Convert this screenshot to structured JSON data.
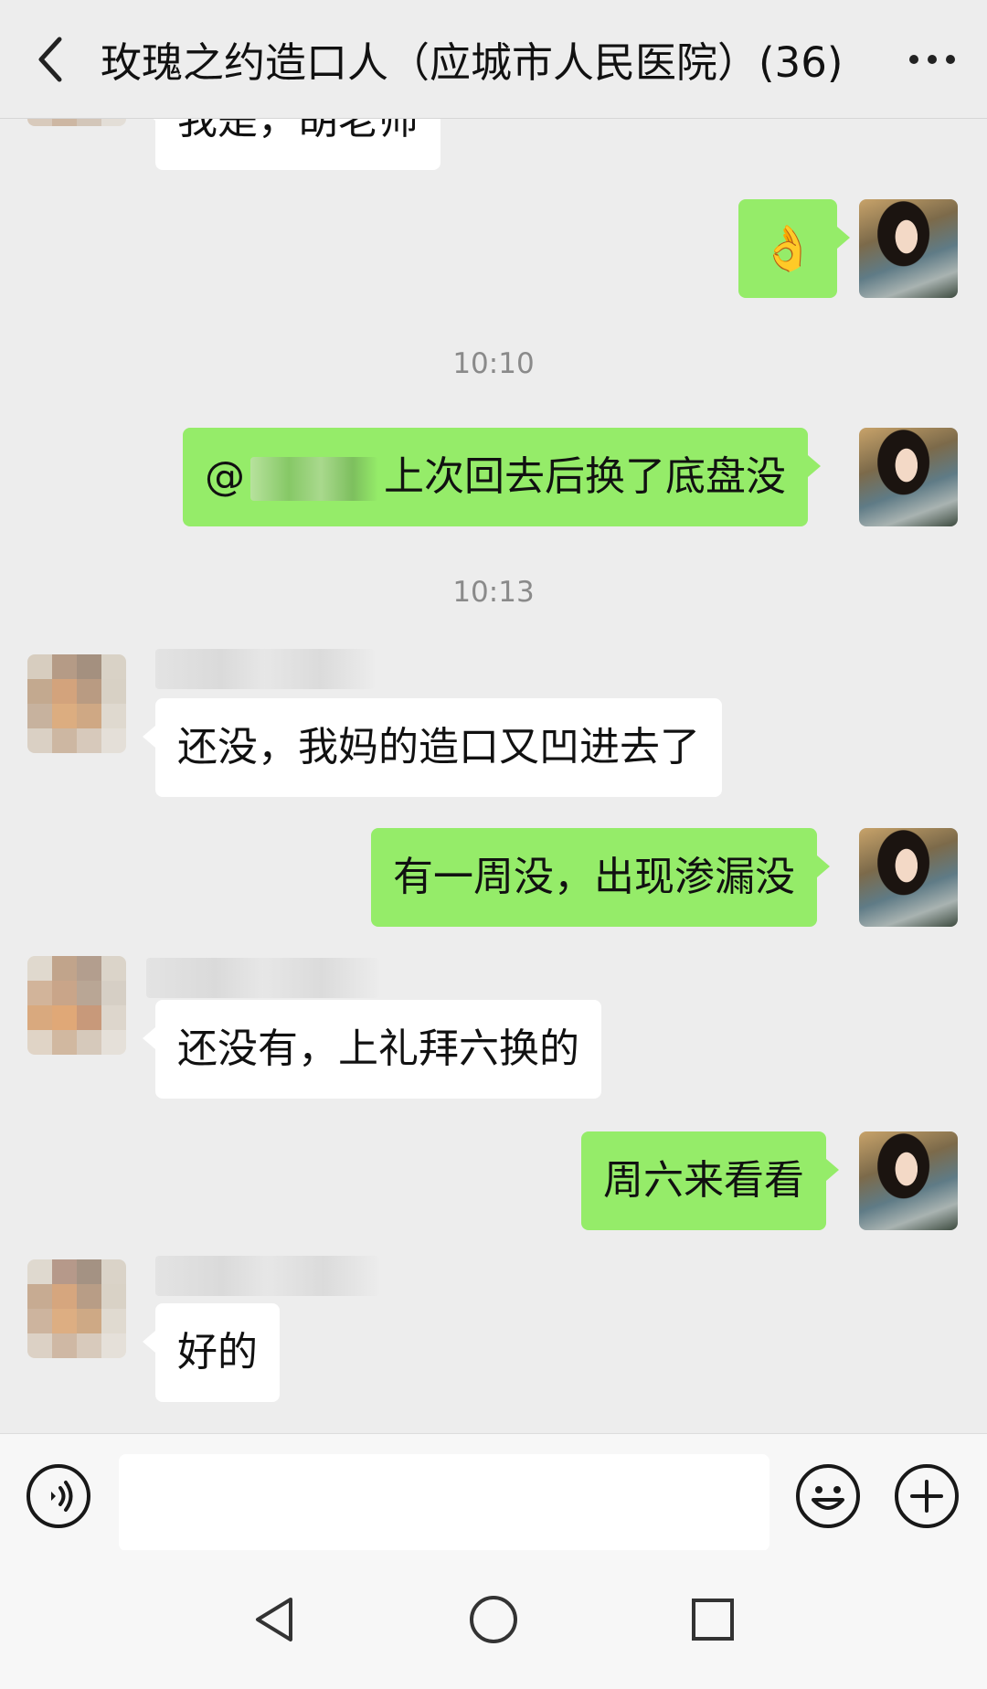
{
  "header": {
    "title": "玫瑰之约造口人（应城市人民医院）(36)"
  },
  "messages": [
    {
      "side": "in",
      "text": "我是，胡老师"
    },
    {
      "side": "out",
      "emoji": "👌"
    },
    {
      "timestamp": "10:10"
    },
    {
      "side": "out",
      "mention": "@",
      "text": "上次回去后换了底盘没"
    },
    {
      "timestamp": "10:13"
    },
    {
      "side": "in",
      "text": "还没，我妈的造口又凹进去了"
    },
    {
      "side": "out",
      "text": "有一周没，出现渗漏没"
    },
    {
      "side": "in",
      "text": "还没有，上礼拜六换的"
    },
    {
      "side": "out",
      "text": "周六来看看"
    },
    {
      "side": "in",
      "text": "好的"
    }
  ],
  "input": {
    "placeholder": ""
  },
  "colors": {
    "outgoing_bubble": "#95ec69",
    "incoming_bubble": "#ffffff",
    "background": "#ededed"
  },
  "icons": [
    "back-icon",
    "more-icon",
    "voice-icon",
    "emoji-icon",
    "plus-icon",
    "nav-back-icon",
    "nav-home-icon",
    "nav-recents-icon"
  ]
}
